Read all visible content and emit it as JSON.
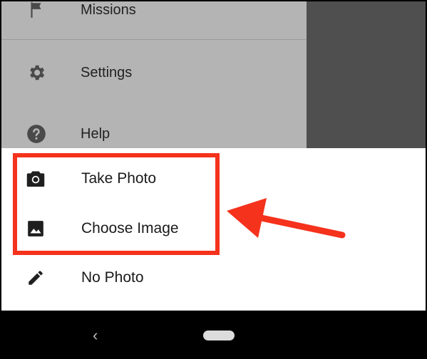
{
  "drawer": {
    "items": [
      {
        "label": "Missions",
        "icon": "flag-icon"
      },
      {
        "label": "Settings",
        "icon": "gear-icon"
      },
      {
        "label": "Help",
        "icon": "help-icon"
      }
    ]
  },
  "sheet": {
    "items": [
      {
        "label": "Take Photo",
        "icon": "camera-icon"
      },
      {
        "label": "Choose Image",
        "icon": "image-icon"
      },
      {
        "label": "No Photo",
        "icon": "pencil-icon"
      }
    ]
  },
  "navbar": {
    "back_glyph": "‹"
  },
  "colors": {
    "drawer_bg": "#b4b4b4",
    "scrim": "#4f4f4f",
    "highlight": "#f5321c",
    "arrow": "#f5321c"
  }
}
